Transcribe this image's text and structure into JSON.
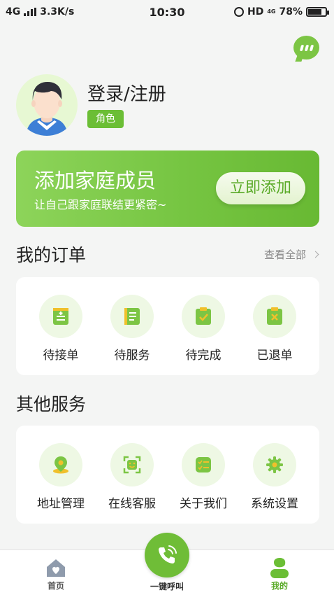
{
  "status_bar": {
    "network": "4G",
    "speed": "3.3K/s",
    "time": "10:30",
    "hd": "HD",
    "network_right": "4G",
    "battery": "78%"
  },
  "profile": {
    "login_label": "登录/注册",
    "role_label": "角色"
  },
  "banner": {
    "title": "添加家庭成员",
    "subtitle": "让自己跟家庭联结更紧密~",
    "button_label": "立即添加"
  },
  "orders": {
    "title": "我的订单",
    "view_all": "查看全部",
    "items": [
      {
        "label": "待接单",
        "icon": "pending-order-icon"
      },
      {
        "label": "待服务",
        "icon": "pending-service-icon"
      },
      {
        "label": "待完成",
        "icon": "pending-complete-icon"
      },
      {
        "label": "已退单",
        "icon": "refunded-order-icon"
      }
    ]
  },
  "services": {
    "title": "其他服务",
    "items": [
      {
        "label": "地址管理",
        "icon": "location-pin-icon"
      },
      {
        "label": "在线客服",
        "icon": "customer-service-icon"
      },
      {
        "label": "关于我们",
        "icon": "about-us-icon"
      },
      {
        "label": "系统设置",
        "icon": "settings-gear-icon"
      }
    ]
  },
  "bottom_nav": {
    "home": "首页",
    "call": "一键呼叫",
    "mine": "我的"
  },
  "colors": {
    "accent": "#6bbe35",
    "accent_light": "#eef8e4",
    "background": "#f4f5f4"
  }
}
